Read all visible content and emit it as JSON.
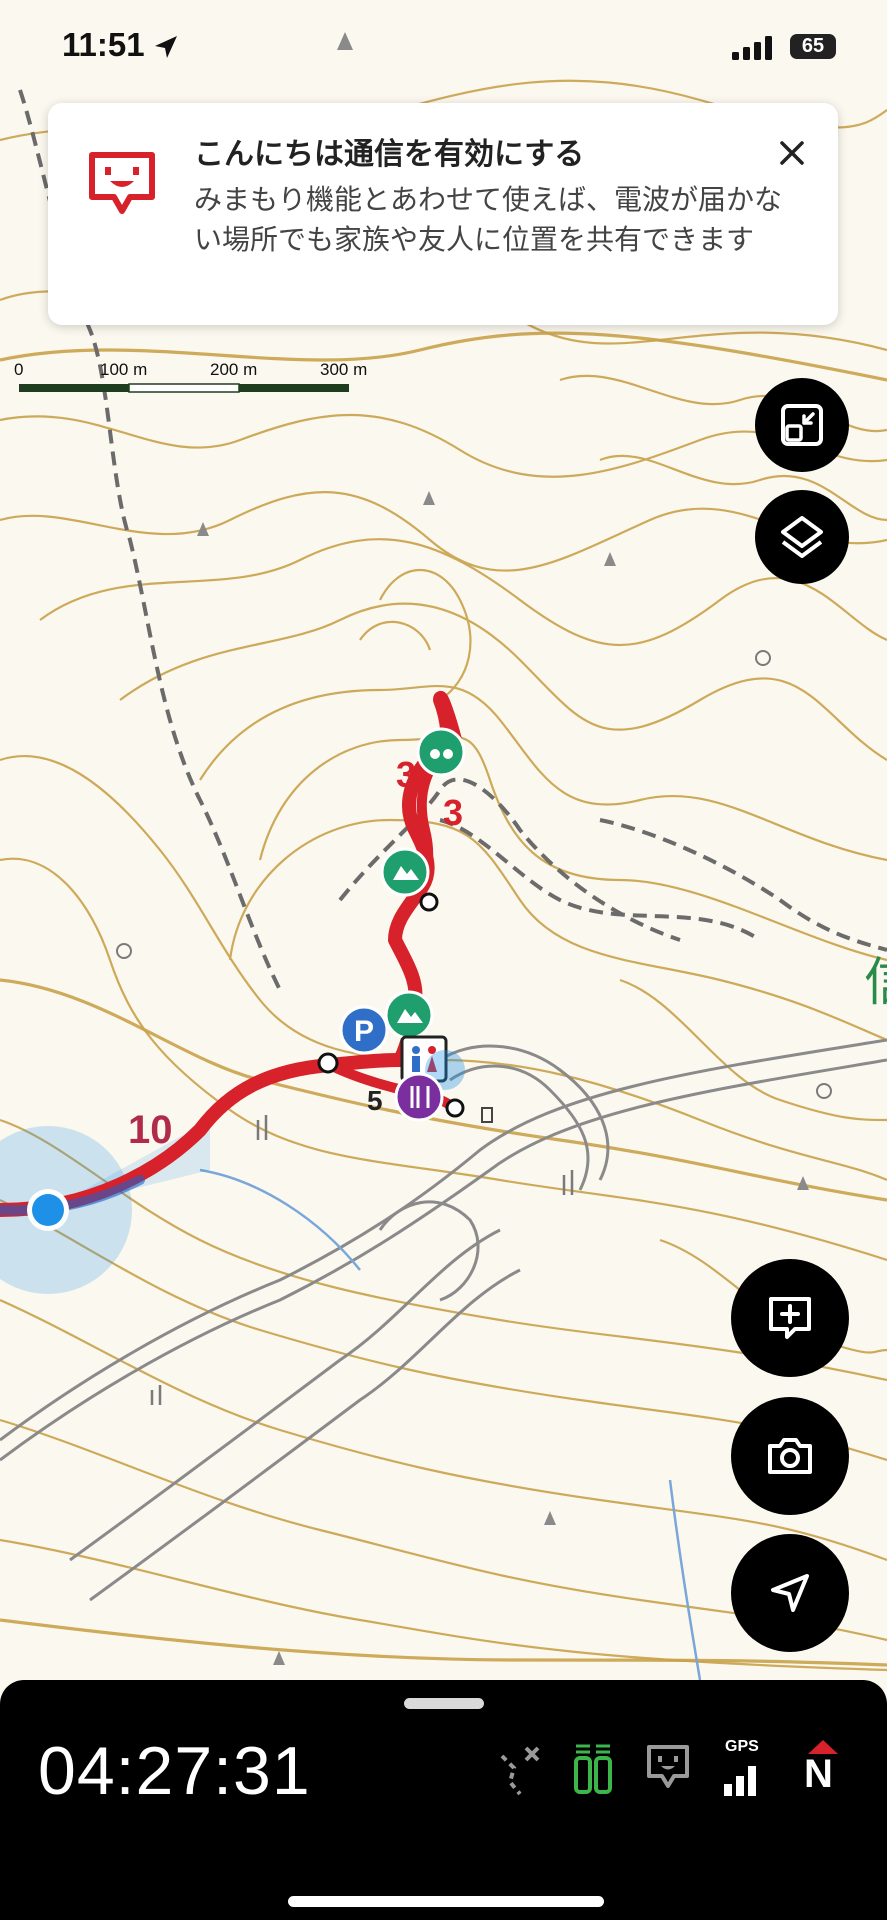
{
  "status_bar": {
    "time": "11:51",
    "battery": "65"
  },
  "banner": {
    "title": "こんにちは通信を有効にする",
    "body": "みまもり機能とあわせて使えば、電波が届かない場所でも家族や友人に位置を共有できます",
    "close_glyph": "×"
  },
  "scale_bar": {
    "labels": [
      "0",
      "100 m",
      "200 m",
      "300 m"
    ]
  },
  "route_labels": [
    "3",
    "3",
    "10",
    "5"
  ],
  "right_buttons": {
    "top": [
      "fit-route-icon",
      "layers-icon"
    ],
    "bottom": [
      "add-memo-icon",
      "camera-icon",
      "current-location-icon"
    ]
  },
  "bottom_sheet": {
    "timer": "04:27:31",
    "gps_label": "GPS",
    "north_label": "N",
    "status_icons": [
      "route-off-icon",
      "battery-saver-icon",
      "konnichiwa-icon",
      "gps-signal-icon",
      "north-up-compass-icon"
    ]
  },
  "colors": {
    "route": "#d7212b",
    "contour": "#c9a14a",
    "map_bg": "#fbf8ef",
    "location": "#1e90e8",
    "poi_green": "#1f9e6e",
    "poi_blue": "#2f6fc7",
    "poi_purple": "#7b2f9e"
  }
}
